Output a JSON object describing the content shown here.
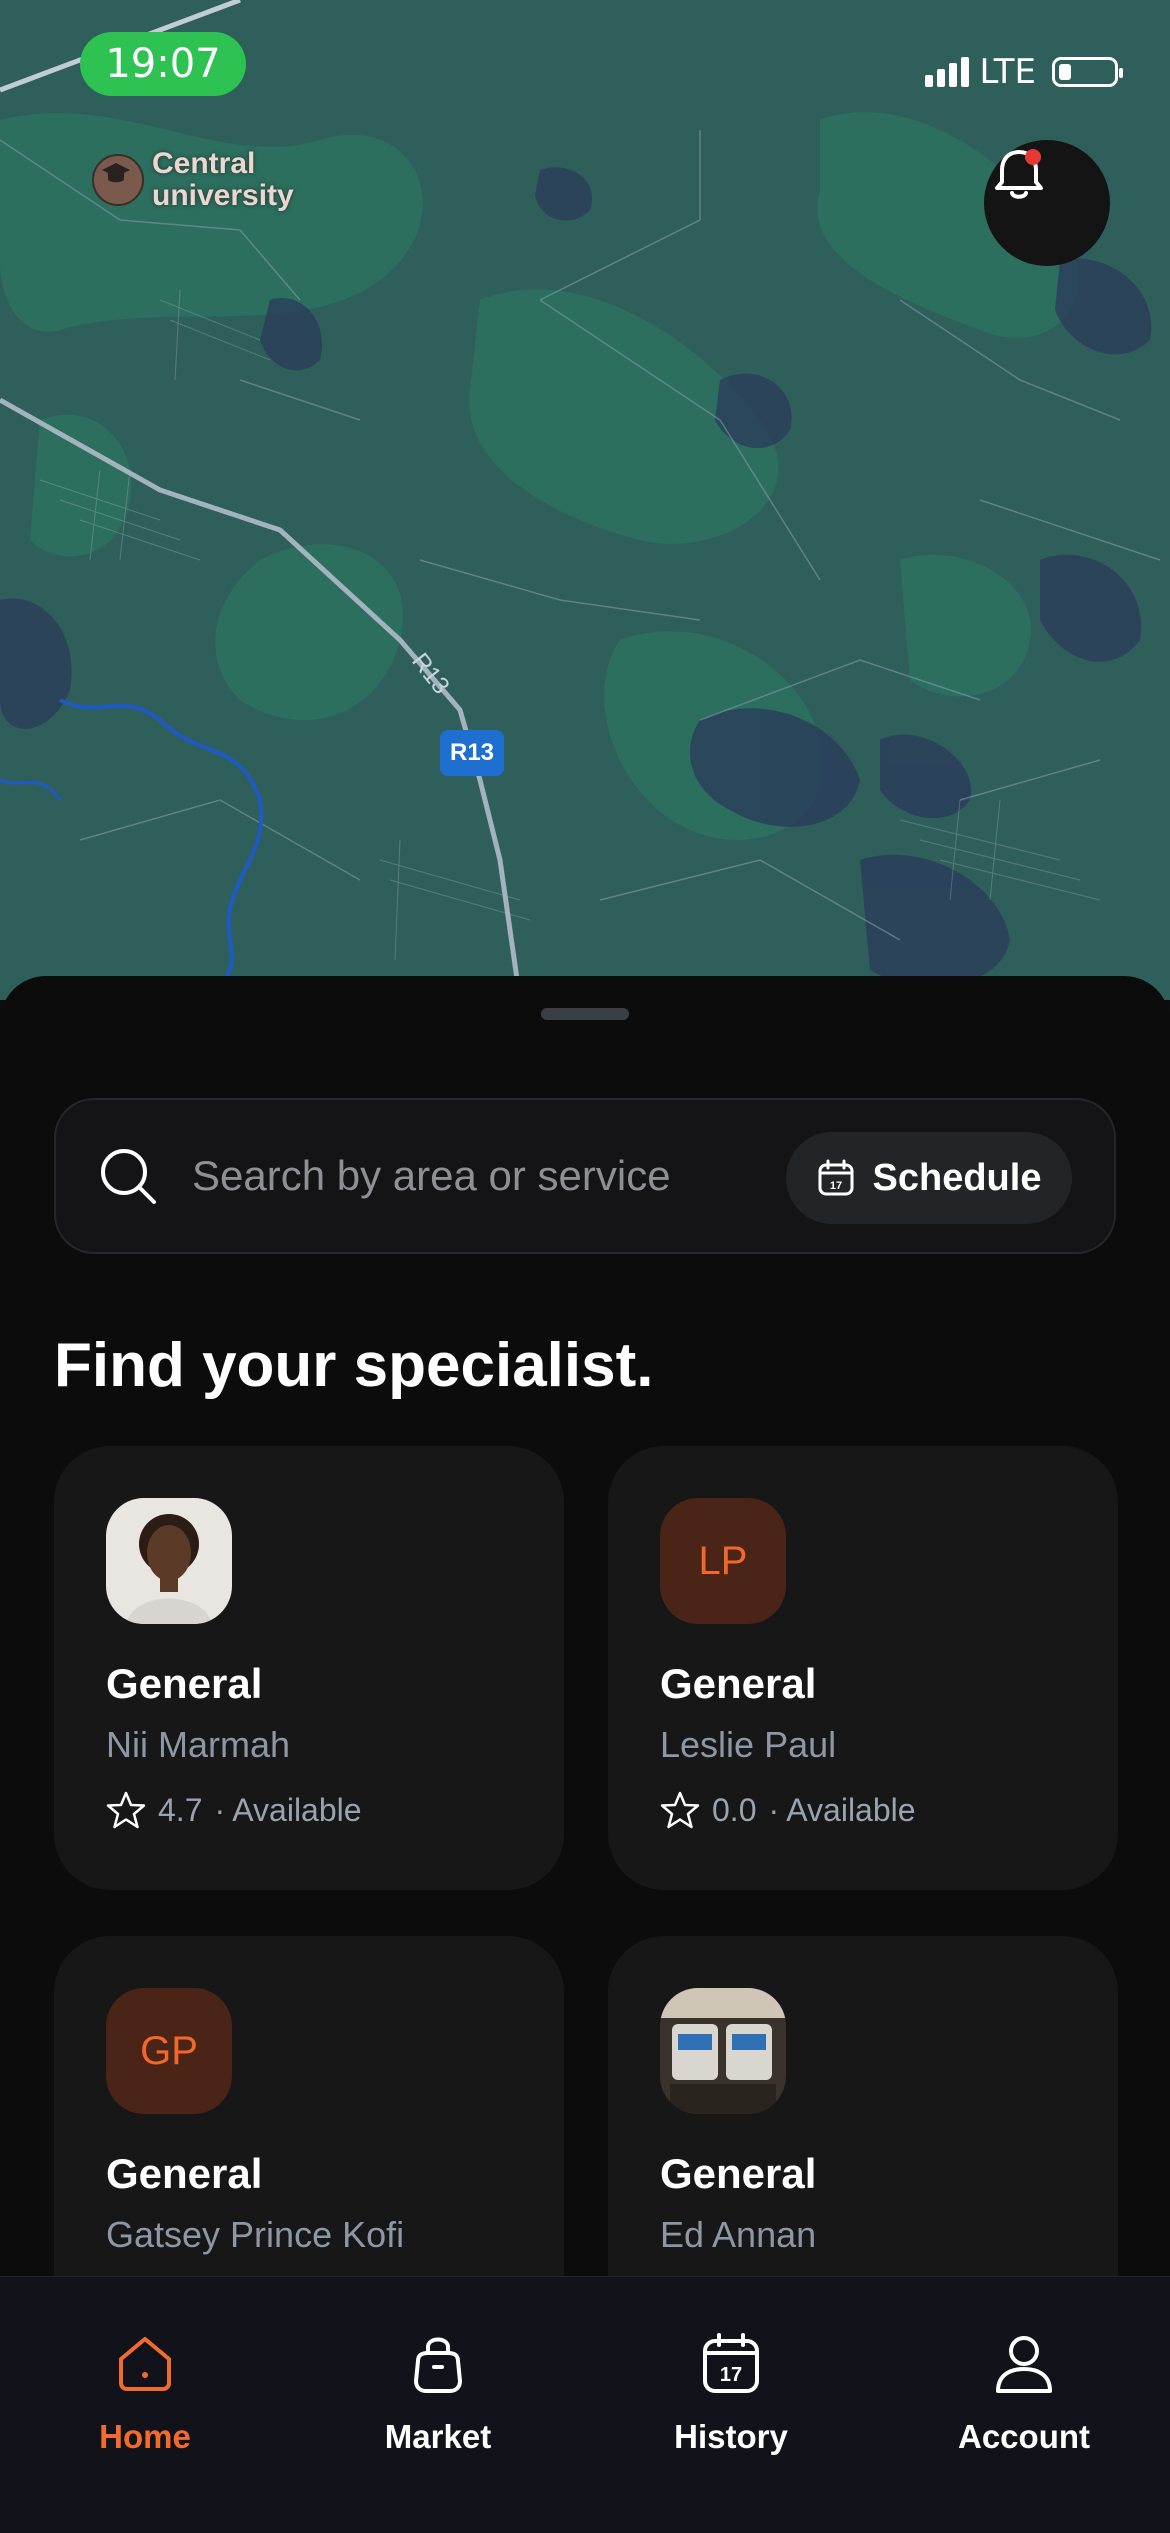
{
  "status_bar": {
    "time": "19:07",
    "network": "LTE"
  },
  "map": {
    "poi_label_line1": "Central",
    "poi_label_line2": "university",
    "road_badge": "R13",
    "road_label": "R13"
  },
  "search": {
    "placeholder": "Search by area or service",
    "schedule_label": "Schedule",
    "calendar_day": "17"
  },
  "section_title": "Find your specialist.",
  "specialists": [
    {
      "title": "General",
      "name": "Nii Marmah",
      "rating": "4.7",
      "status": "· Available",
      "avatar_type": "photo"
    },
    {
      "title": "General",
      "name": "Leslie Paul",
      "rating": "0.0",
      "status": "· Available",
      "initials": "LP"
    },
    {
      "title": "General",
      "name": "Gatsey Prince Kofi",
      "initials": "GP"
    },
    {
      "title": "General",
      "name": "Ed Annan",
      "avatar_type": "photo"
    }
  ],
  "nav": [
    {
      "label": "Home",
      "icon": "home-icon",
      "active": true
    },
    {
      "label": "Market",
      "icon": "bag-icon"
    },
    {
      "label": "History",
      "icon": "calendar-icon",
      "day": "17"
    },
    {
      "label": "Account",
      "icon": "user-icon"
    }
  ],
  "colors": {
    "accent": "#f26a2c",
    "status_green": "#2ec253",
    "map_base": "#2f5f5b",
    "sheet_bg": "#0c0c0d"
  }
}
